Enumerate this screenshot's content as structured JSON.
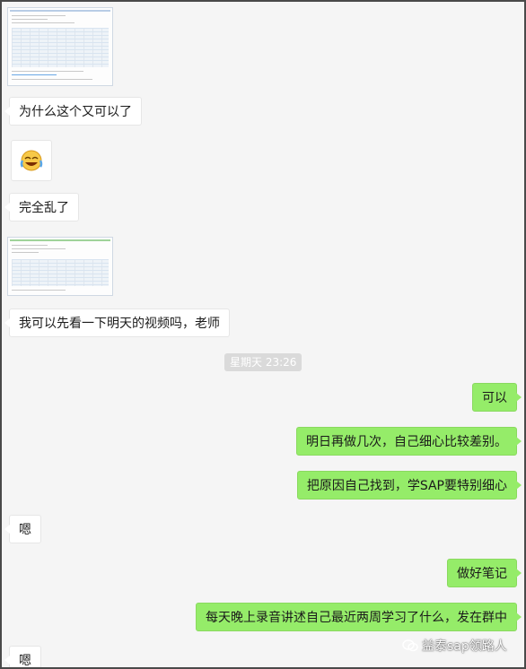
{
  "messages": [
    {
      "side": "in",
      "type": "text",
      "text": "为什么这个又可以了"
    },
    {
      "side": "in",
      "type": "text",
      "text": "完全乱了"
    },
    {
      "side": "in",
      "type": "text",
      "text": "我可以先看一下明天的视频吗，老师"
    },
    {
      "side": "out",
      "type": "text",
      "text": "可以"
    },
    {
      "side": "out",
      "type": "text",
      "text": "明日再做几次，自己细心比较差别。"
    },
    {
      "side": "out",
      "type": "text",
      "text": "把原因自己找到，学SAP要特别细心"
    },
    {
      "side": "in",
      "type": "text",
      "text": "嗯"
    },
    {
      "side": "out",
      "type": "text",
      "text": "做好笔记"
    },
    {
      "side": "out",
      "type": "text",
      "text": "每天晚上录音讲述自己最近两周学习了什么，发在群中"
    },
    {
      "side": "in",
      "type": "text",
      "text": "嗯"
    }
  ],
  "timestamp": "星期天 23:26",
  "emoji": {
    "icon": "laughing-crying-face-icon"
  },
  "images": [
    {
      "icon": "sap-screenshot-thumbnail"
    },
    {
      "icon": "sap-screenshot-thumbnail"
    }
  ],
  "watermark": {
    "icon": "wechat-icon",
    "text": "益泰sap领路人"
  },
  "colors": {
    "background": "#f5f5f5",
    "incoming_bubble": "#ffffff",
    "outgoing_bubble": "#95ec69",
    "timestamp_bg": "#dadada"
  }
}
